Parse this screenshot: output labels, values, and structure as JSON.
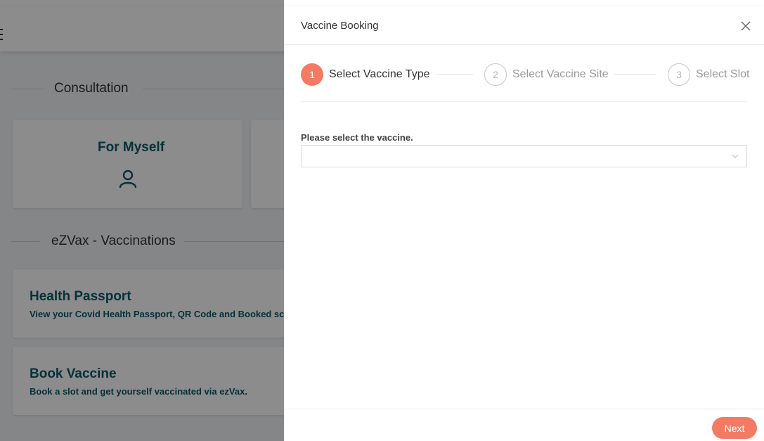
{
  "background": {
    "sections": {
      "consultation_title": "Consultation",
      "vaccinations_title": "eZVax - Vaccinations"
    },
    "cards": {
      "for_myself_label": "For Myself",
      "health_passport_title": "Health Passport",
      "health_passport_desc": "View your Covid Health Passport, QR Code and Booked schedules",
      "book_vaccine_title": "Book Vaccine",
      "book_vaccine_desc": "Book a slot and get yourself vaccinated via ezVax."
    },
    "icons": {
      "menu": "hamburger-menu-icon",
      "person": "person-icon"
    }
  },
  "drawer": {
    "title": "Vaccine Booking",
    "close_icon": "close-icon",
    "steps": [
      {
        "number": "1",
        "label": "Select Vaccine Type",
        "state": "active"
      },
      {
        "number": "2",
        "label": "Select Vaccine Site",
        "state": "inactive"
      },
      {
        "number": "3",
        "label": "Select Slot",
        "state": "inactive"
      }
    ],
    "form": {
      "vaccine_label": "Please select the vaccine.",
      "vaccine_value": ""
    },
    "next_label": "Next"
  },
  "colors": {
    "accent": "#f47a63",
    "brand_teal": "#115866",
    "overlay": "rgba(0,0,0,0.45)"
  }
}
